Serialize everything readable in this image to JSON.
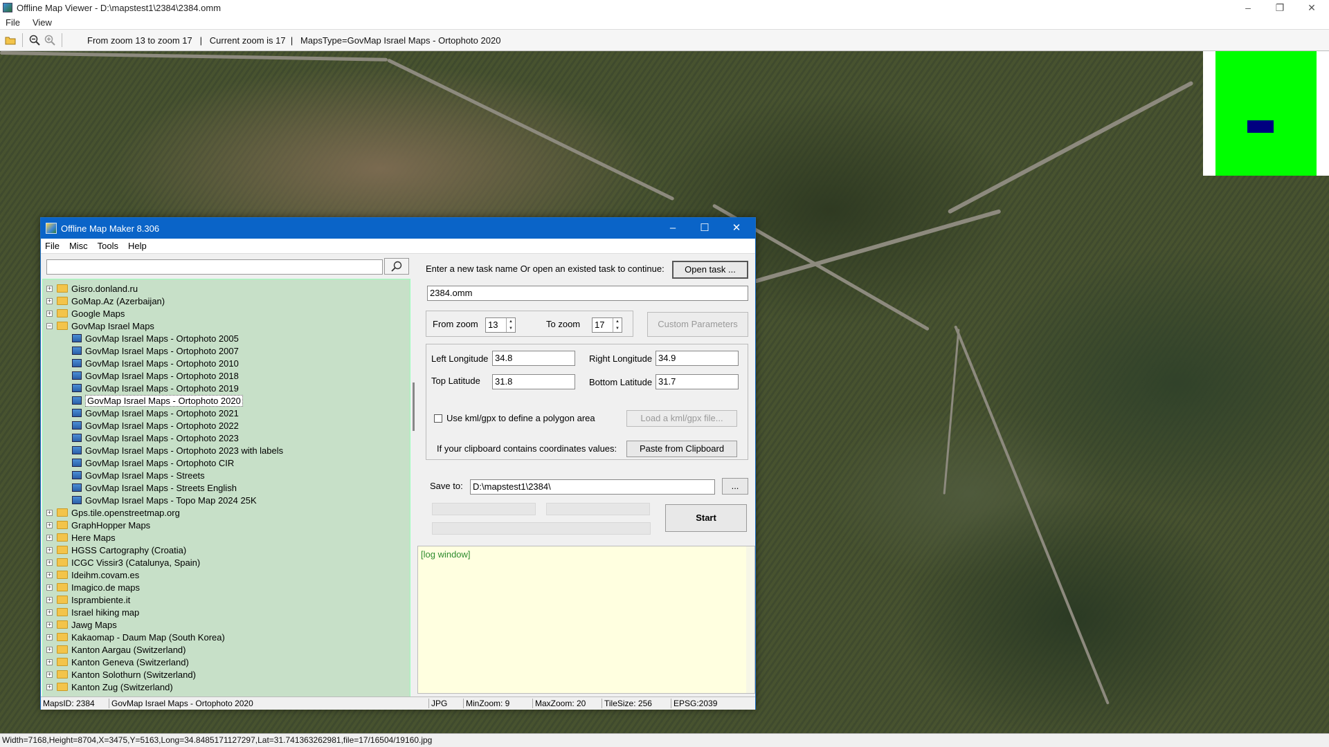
{
  "app": {
    "title": "Offline Map Viewer - D:\\mapstest1\\2384\\2384.omm",
    "menu": [
      "File",
      "View"
    ],
    "toolbar_info": "From zoom 13 to zoom 17   |   Current zoom is 17  |   MapsType=GovMap Israel Maps - Ortophoto 2020",
    "status": "Width=7168,Height=8704,X=3475,Y=5163,Long=34.8485171127297,Lat=31.741363262981,file=17/16504/19160.jpg"
  },
  "dialog": {
    "title": "Offline Map Maker 8.306",
    "menu": [
      "File",
      "Misc",
      "Tools",
      "Help"
    ],
    "search_value": "",
    "tree": [
      {
        "label": "Gisro.donland.ru",
        "type": "folder",
        "expanded": false
      },
      {
        "label": "GoMap.Az (Azerbaijan)",
        "type": "folder",
        "expanded": false
      },
      {
        "label": "Google Maps",
        "type": "folder",
        "expanded": false
      },
      {
        "label": "GovMap Israel Maps",
        "type": "folder",
        "expanded": true
      },
      {
        "label": "GovMap Israel Maps - Ortophoto 2005",
        "type": "map"
      },
      {
        "label": "GovMap Israel Maps - Ortophoto 2007",
        "type": "map"
      },
      {
        "label": "GovMap Israel Maps - Ortophoto 2010",
        "type": "map"
      },
      {
        "label": "GovMap Israel Maps - Ortophoto 2018",
        "type": "map"
      },
      {
        "label": "GovMap Israel Maps - Ortophoto 2019",
        "type": "map"
      },
      {
        "label": "GovMap Israel Maps - Ortophoto 2020",
        "type": "map",
        "selected": true
      },
      {
        "label": "GovMap Israel Maps - Ortophoto 2021",
        "type": "map"
      },
      {
        "label": "GovMap Israel Maps - Ortophoto 2022",
        "type": "map"
      },
      {
        "label": "GovMap Israel Maps - Ortophoto 2023",
        "type": "map"
      },
      {
        "label": "GovMap Israel Maps - Ortophoto 2023 with labels",
        "type": "map"
      },
      {
        "label": "GovMap Israel Maps - Ortophoto CIR",
        "type": "map"
      },
      {
        "label": "GovMap Israel Maps - Streets",
        "type": "map"
      },
      {
        "label": "GovMap Israel Maps - Streets English",
        "type": "map"
      },
      {
        "label": "GovMap Israel Maps - Topo Map 2024 25K",
        "type": "map"
      },
      {
        "label": "Gps.tile.openstreetmap.org",
        "type": "folder",
        "expanded": false
      },
      {
        "label": "GraphHopper Maps",
        "type": "folder",
        "expanded": false
      },
      {
        "label": "Here Maps",
        "type": "folder",
        "expanded": false
      },
      {
        "label": "HGSS Cartography (Croatia)",
        "type": "folder",
        "expanded": false
      },
      {
        "label": "ICGC Vissir3 (Catalunya, Spain)",
        "type": "folder",
        "expanded": false
      },
      {
        "label": "Ideihm.covam.es",
        "type": "folder",
        "expanded": false
      },
      {
        "label": "Imagico.de maps",
        "type": "folder",
        "expanded": false
      },
      {
        "label": "Isprambiente.it",
        "type": "folder",
        "expanded": false
      },
      {
        "label": "Israel hiking map",
        "type": "folder",
        "expanded": false
      },
      {
        "label": "Jawg Maps",
        "type": "folder",
        "expanded": false
      },
      {
        "label": "Kakaomap - Daum Map (South Korea)",
        "type": "folder",
        "expanded": false
      },
      {
        "label": "Kanton Aargau (Switzerland)",
        "type": "folder",
        "expanded": false
      },
      {
        "label": "Kanton Geneva (Switzerland)",
        "type": "folder",
        "expanded": false
      },
      {
        "label": "Kanton Solothurn (Switzerland)",
        "type": "folder",
        "expanded": false
      },
      {
        "label": "Kanton Zug (Switzerland)",
        "type": "folder",
        "expanded": false
      }
    ],
    "task_prompt": "Enter a new task name Or open an existed task to continue:",
    "open_task_label": "Open task ...",
    "task_name": "2384.omm",
    "from_zoom_label": "From zoom",
    "from_zoom": "13",
    "to_zoom_label": "To zoom",
    "to_zoom": "17",
    "custom_params_label": "Custom Parameters",
    "left_long_label": "Left Longitude",
    "left_long": "34.8",
    "right_long_label": "Right Longitude",
    "right_long": "34.9",
    "top_lat_label": "Top Latitude",
    "top_lat": "31.8",
    "bottom_lat_label": "Bottom Latitude",
    "bottom_lat": "31.7",
    "kml_label": "Use kml/gpx to define a polygon area",
    "load_kml_label": "Load a kml/gpx file...",
    "clipboard_prompt": "If your clipboard contains coordinates values:",
    "paste_label": "Paste from Clipboard",
    "save_to_label": "Save to:",
    "save_to": "D:\\mapstest1\\2384\\",
    "browse_label": "...",
    "start_label": "Start",
    "log_text": "[log window]",
    "status": {
      "maps_id": "MapsID: 2384",
      "map_name": "GovMap Israel Maps - Ortophoto 2020",
      "format": "JPG",
      "min_zoom": "MinZoom: 9",
      "max_zoom": "MaxZoom: 20",
      "tile_size": "TileSize: 256",
      "epsg": "EPSG:2039"
    }
  }
}
